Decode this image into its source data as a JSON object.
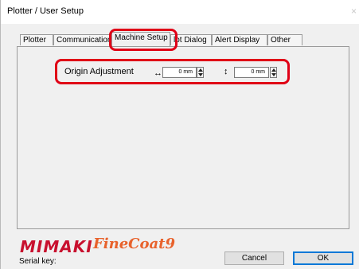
{
  "window": {
    "title": "Plotter / User Setup",
    "close_glyph": "×"
  },
  "tabs": [
    {
      "label": "Plotter"
    },
    {
      "label": "Communication"
    },
    {
      "label": "Machine Setup",
      "active": true
    },
    {
      "label": "lot Dialog"
    },
    {
      "label": "Alert Display"
    },
    {
      "label": "Other"
    }
  ],
  "machine_setup": {
    "origin_label": "Origin Adjustment",
    "horizontal_arrow": "↔",
    "vertical_arrow": "↕",
    "x_value": "0 mm",
    "y_value": "0 mm"
  },
  "footer": {
    "logo_brand": "MIMAKI",
    "logo_product": "FineCoat9",
    "serial_label": "Serial key:",
    "cancel_label": "Cancel",
    "ok_label": "OK"
  },
  "colors": {
    "highlight": "#e00016",
    "brand_red": "#c8102e",
    "product_orange": "#e8622c",
    "default_button_border": "#0078d7"
  }
}
